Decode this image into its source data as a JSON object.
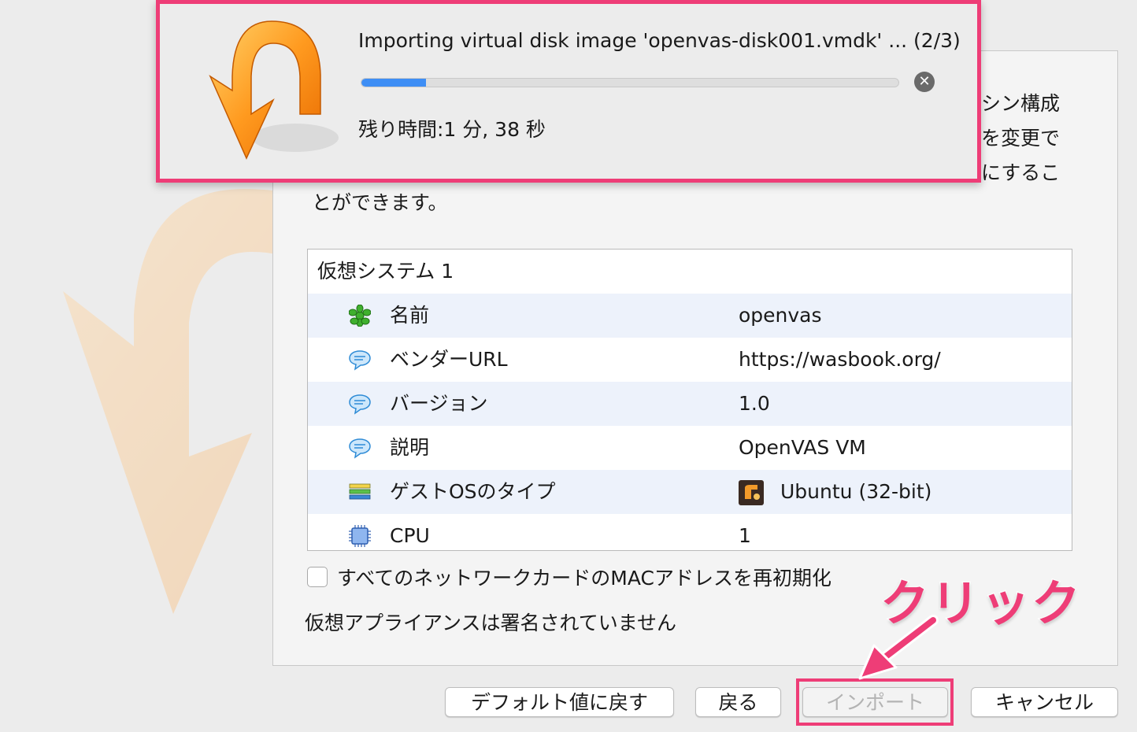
{
  "progress": {
    "title": "Importing virtual disk image 'openvas-disk001.vmdk' ... (2/3)",
    "value_percent": 12,
    "remaining": "残り時間:1 分, 38 秒",
    "cancel_icon": "close-circle-icon"
  },
  "description": {
    "right_lines": [
      "シン構成",
      "を変更で",
      "にするこ"
    ],
    "bottom_line": "とができます。"
  },
  "table": {
    "system_title": "仮想システム 1",
    "rows": [
      {
        "key": "名前",
        "value": "openvas",
        "icon": "name-icon"
      },
      {
        "key": "ベンダーURL",
        "value": "https://wasbook.org/",
        "icon": "info-bubble-icon"
      },
      {
        "key": "バージョン",
        "value": "1.0",
        "icon": "info-bubble-icon"
      },
      {
        "key": "説明",
        "value": "OpenVAS VM",
        "icon": "info-bubble-icon"
      },
      {
        "key": "ゲストOSのタイプ",
        "value": "Ubuntu (32-bit)",
        "icon": "os-type-icon"
      },
      {
        "key": "CPU",
        "value": "1",
        "icon": "cpu-icon"
      }
    ]
  },
  "reinit_mac": {
    "label": "すべてのネットワークカードのMACアドレスを再初期化",
    "checked": false
  },
  "unsigned_note": "仮想アプライアンスは署名されていません",
  "buttons": {
    "restore_defaults": "デフォルト値に戻す",
    "back": "戻る",
    "import": "インポート",
    "cancel": "キャンセル"
  },
  "annotation": {
    "label": "クリック",
    "color": "#ee3d77"
  }
}
